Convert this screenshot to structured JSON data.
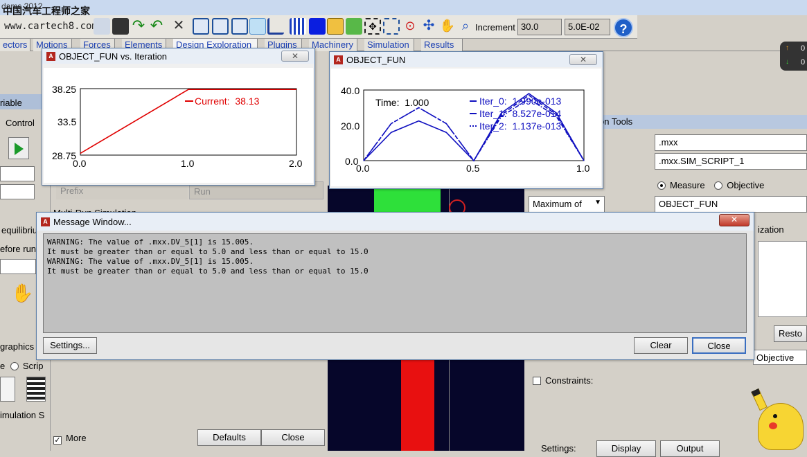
{
  "app": {
    "title": "dams 2012",
    "watermark_cn": "中国汽车工程师之家",
    "watermark_url": "www.cartech8.com"
  },
  "toolbar": {
    "increment_label": "Increment",
    "increment_value": "30.0",
    "increment_step": "5.0E-02",
    "help": "?"
  },
  "menu_tabs": [
    "ectors",
    "Motions",
    "Forces",
    "Elements",
    "Design Exploration",
    "Plugins",
    "Machinery",
    "Simulation",
    "Results"
  ],
  "left_panel": {
    "variable_label": "riable",
    "control_label": "Control",
    "equilibrium_label": "equilibriu",
    "before_run_label": "efore run",
    "graphics_label": "graphics d",
    "radio_e": "e",
    "script_label": "Scrip",
    "simulation_label": "imulation S"
  },
  "sim_panel": {
    "prefix_label": "Prefix",
    "run_label": "Run",
    "multi_run_label": "Multi-Run Simulation",
    "more_label": "More",
    "defaults_button": "Defaults",
    "close_button": "Close"
  },
  "right_panel": {
    "tools_label": "on Tools",
    "model_value": ".mxx",
    "script_value": ".mxx.SIM_SCRIPT_1",
    "measure_label": "Measure",
    "objective_label": "Objective",
    "maximum_of": "Maximum of",
    "object_value": "OBJECT_FUN",
    "optimization_label": "ization",
    "restore_button": "Resto",
    "objective_label2": "Objective",
    "constraints_label": "Constraints:",
    "settings_label": "Settings:",
    "display_button": "Display",
    "output_button": "Output"
  },
  "status": {
    "up_value": "0",
    "down_value": "0"
  },
  "plot1": {
    "title": "OBJECT_FUN vs. Iteration",
    "current_label": "Current:",
    "current_value": "38.13",
    "y_ticks": [
      "38.25",
      "33.5",
      "28.75"
    ],
    "x_ticks": [
      "0.0",
      "1.0",
      "2.0"
    ]
  },
  "plot2": {
    "title": "OBJECT_FUN",
    "time_label": "Time:",
    "time_value": "1.000",
    "y_ticks": [
      "40.0",
      "20.0",
      "0.0"
    ],
    "x_ticks": [
      "0.0",
      "0.5",
      "1.0"
    ],
    "legend": [
      {
        "name": "Iter_0:",
        "value": "1.990e-013"
      },
      {
        "name": "Iter_1:",
        "value": "8.527e-014"
      },
      {
        "name": "Iter_2:",
        "value": "1.137e-013"
      }
    ]
  },
  "message_window": {
    "title": "Message Window...",
    "lines": "WARNING: The value of .mxx.DV_5[1] is 15.005.\nIt must be greater than or equal to 5.0 and less than or equal to 15.0\nWARNING: The value of .mxx.DV_5[1] is 15.005.\nIt must be greater than or equal to 5.0 and less than or equal to 15.0",
    "settings_button": "Settings...",
    "clear_button": "Clear",
    "close_button": "Close"
  },
  "chart_data": [
    {
      "type": "line",
      "title": "OBJECT_FUN vs. Iteration",
      "xlim": [
        0.0,
        2.0
      ],
      "ylim": [
        28.75,
        38.25
      ],
      "series": [
        {
          "name": "Current",
          "color": "#e00000",
          "x": [
            0.0,
            1.0,
            2.0
          ],
          "y": [
            29.0,
            38.13,
            38.13
          ]
        }
      ]
    },
    {
      "type": "line",
      "title": "OBJECT_FUN",
      "xlim": [
        0.0,
        1.0
      ],
      "ylim": [
        0.0,
        40.0
      ],
      "series": [
        {
          "name": "Iter_0",
          "color": "#1010c0",
          "style": "solid",
          "x": [
            0,
            0.125,
            0.25,
            0.375,
            0.5,
            0.625,
            0.75,
            0.875,
            1.0
          ],
          "y": [
            0,
            16,
            22.5,
            16,
            0,
            27,
            38,
            27,
            0
          ]
        },
        {
          "name": "Iter_1",
          "color": "#1010c0",
          "style": "dash",
          "x": [
            0,
            0.125,
            0.25,
            0.375,
            0.5,
            0.625,
            0.75,
            0.875,
            1.0
          ],
          "y": [
            0,
            21,
            30,
            21,
            0,
            26,
            37,
            26,
            0
          ]
        },
        {
          "name": "Iter_2",
          "color": "#1010c0",
          "style": "dashdot",
          "x": [
            0,
            0.125,
            0.25,
            0.375,
            0.5,
            0.625,
            0.75,
            0.875,
            1.0
          ],
          "y": [
            0,
            21,
            30,
            21,
            0,
            25,
            35,
            25,
            0
          ]
        }
      ]
    }
  ]
}
